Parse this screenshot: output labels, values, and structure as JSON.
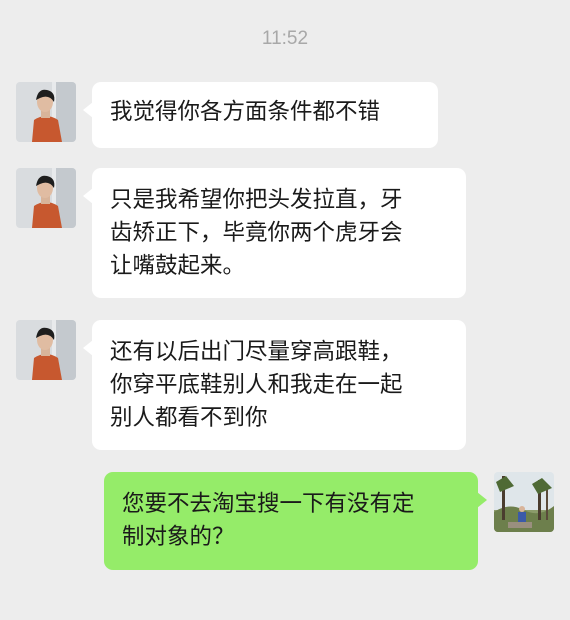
{
  "chat": {
    "timestamp": "11:52",
    "messages": [
      {
        "sender": "contact",
        "lines": [
          "我觉得你各方面条件都不错"
        ]
      },
      {
        "sender": "contact",
        "lines": [
          "只是我希望你把头发拉直，牙",
          "齿矫正下，毕竟你两个虎牙会",
          "让嘴鼓起来。"
        ]
      },
      {
        "sender": "contact",
        "lines": [
          "还有以后出门尽量穿高跟鞋，",
          "你穿平底鞋别人和我走在一起",
          "别人都看不到你"
        ]
      },
      {
        "sender": "me",
        "lines": [
          "您要不去淘宝搜一下有没有定",
          "制对象的？"
        ]
      }
    ]
  },
  "colors": {
    "background": "#ededed",
    "incoming_bubble": "#ffffff",
    "outgoing_bubble": "#95ec69"
  },
  "icons": {
    "contact_avatar": "contact-avatar-photo",
    "my_avatar": "my-avatar-landscape-photo"
  }
}
